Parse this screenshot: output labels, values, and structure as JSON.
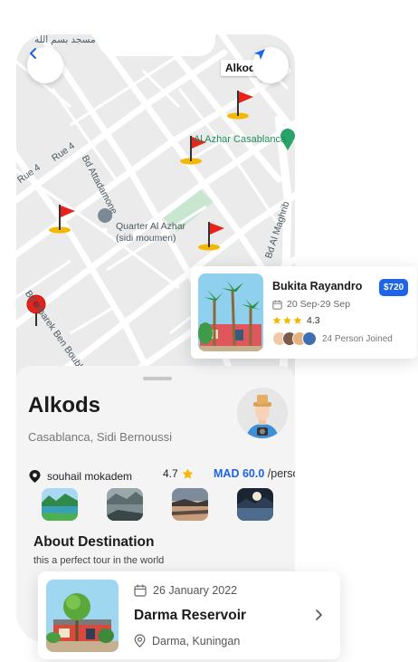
{
  "map": {
    "top_arabic_label": "مسجد بسم الله",
    "place_tag": "Alkods",
    "labels": {
      "azhar_casablanca": "Al Azhar Casablanca",
      "quarter_line1": "Quarter Al Azhar",
      "quarter_line2": "(sidi moumen)",
      "rue4_a": "Rue 4",
      "rue4_b": "Rue 4",
      "bd_attadamone": "Bd Attadamone",
      "bd_mbarek": "Bd Mbarek Ben Boubker Hammadi",
      "bd_al_maghrib": "Bd Al Maghrib"
    }
  },
  "destination": {
    "title": "Alkods",
    "location": "Casablanca, Sidi Bernoussi",
    "host": "souhail mokadem",
    "rating": "4.7",
    "price": "MAD 60.0",
    "price_unit": "/person",
    "about_title": "About Destination",
    "about_text": "this a perfect tour in the world"
  },
  "tour_card": {
    "title": "Bukita Rayandro",
    "price": "$720",
    "dates": "20 Sep-29 Sep",
    "rating": "4.3",
    "joined": "24 Person Joined"
  },
  "reservoir_card": {
    "date": "26 January 2022",
    "title": "Darma Reservoir",
    "location": "Darma, Kuningan"
  },
  "colors": {
    "accent": "#1e63e8",
    "star": "#f5b800",
    "flag": "#e8231c",
    "park_green": "#c8e6d0"
  }
}
